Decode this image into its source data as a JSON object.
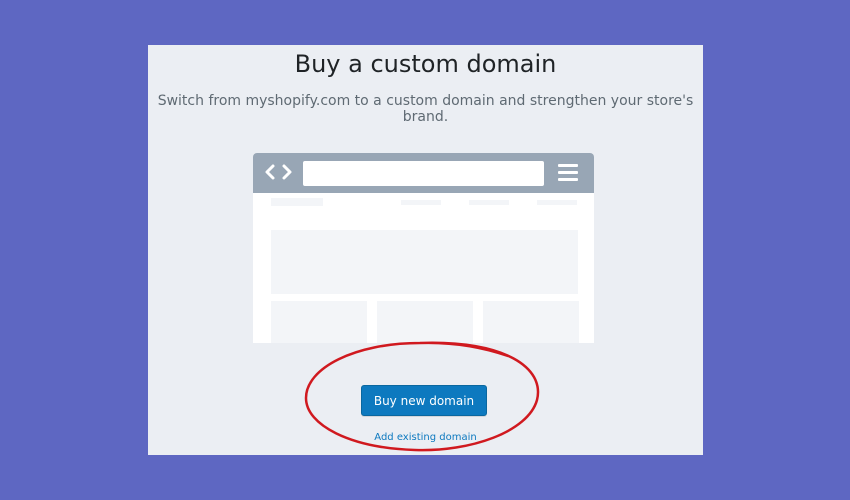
{
  "card": {
    "title": "Buy a custom domain",
    "subtitle": "Switch from myshopify.com to a custom domain and strengthen your store's brand."
  },
  "illustration": {
    "nav_icon": "back-forward-arrows-icon",
    "menu_icon": "hamburger-menu-icon"
  },
  "actions": {
    "primary_label": "Buy new domain",
    "secondary_label": "Add existing domain"
  },
  "colors": {
    "background": "#5e67c2",
    "card": "#ebeef3",
    "primary": "#0d79bf",
    "annotation": "#d0191f"
  }
}
